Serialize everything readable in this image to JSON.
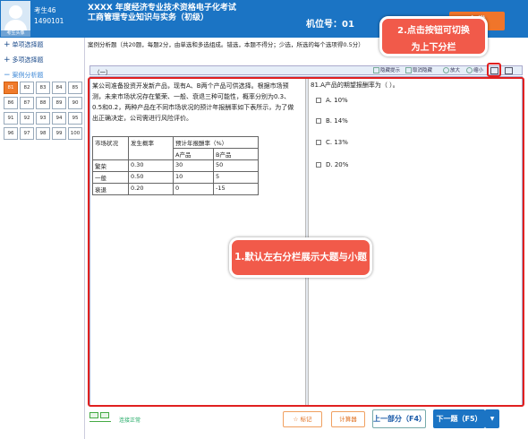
{
  "header": {
    "candidate_label": "考生46",
    "candidate_id": "1490101",
    "avatar_caption": "考生头像",
    "title_line1": "XXXX 年度经济专业技术资格电子化考试",
    "title_line2": "工商管理专业知识与实务（初级）",
    "seat_label": "机位号：01",
    "submit_label": "交卷"
  },
  "sidebar": {
    "sections": [
      {
        "label": "单项选择题",
        "icon": "plus"
      },
      {
        "label": "多项选择题",
        "icon": "plus"
      },
      {
        "label": "案例分析题",
        "icon": "minus"
      }
    ],
    "question_numbers": [
      "81",
      "82",
      "83",
      "84",
      "85",
      "86",
      "87",
      "88",
      "89",
      "90",
      "91",
      "92",
      "93",
      "94",
      "95",
      "96",
      "97",
      "98",
      "99",
      "100"
    ],
    "current_question": "81"
  },
  "main": {
    "description": "案例分析题（共20题，每题2分，由单选和多选组成。错选，本题不得分；少选，所选的每个选项得0.5分）",
    "panel_label": "（一）",
    "toolbar": [
      {
        "label": "隐藏提示",
        "icon": "hide-icon"
      },
      {
        "label": "取消隐藏",
        "icon": "show-icon"
      },
      {
        "label": "放大",
        "icon": "zoom-in-icon"
      },
      {
        "label": "缩小",
        "icon": "zoom-out-icon"
      }
    ],
    "stem": "某公司准备投资开发新产品，现有A、B两个产品可供选择。根据市场预测，未来市场状况存在繁荣、一般、衰退三种可能性，概率分别为0.3、0.5和0.2，两种产品在不同市场状况的预计年报酬率如下表所示，为了做出正确决定，公司需进行风险评价。",
    "table": {
      "h1": "市场状况",
      "h2": "发生概率",
      "h3": "预计年报酬率（%）",
      "h3a": "A产品",
      "h3b": "B产品",
      "rows": [
        {
          "state": "繁荣",
          "prob": "0.30",
          "a": "30",
          "b": "50"
        },
        {
          "state": "一般",
          "prob": "0.50",
          "a": "10",
          "b": "5"
        },
        {
          "state": "衰退",
          "prob": "0.20",
          "a": "0",
          "b": "-15"
        }
      ]
    },
    "question": "81.A产品的期望报酬率为（        ）。",
    "options": [
      "A. 10%",
      "B. 14%",
      "C. 13%",
      "D. 20%"
    ]
  },
  "tips": {
    "tip1": "1.默认左右分栏展示大题与小题",
    "tip2_line1": "2.点击按钮可切换",
    "tip2_line2": "为上下分栏"
  },
  "footer": {
    "connection": "连接正常",
    "mark": "☆ 标记",
    "calculator": "计算器",
    "prev": "上一部分（F4）",
    "next": "下一题（F5）",
    "next_dropdown": "▼"
  },
  "colors": {
    "header": "#1b74c4",
    "submit": "#f0752a",
    "tip": "#f15a4a",
    "highlight": "#e02020"
  }
}
